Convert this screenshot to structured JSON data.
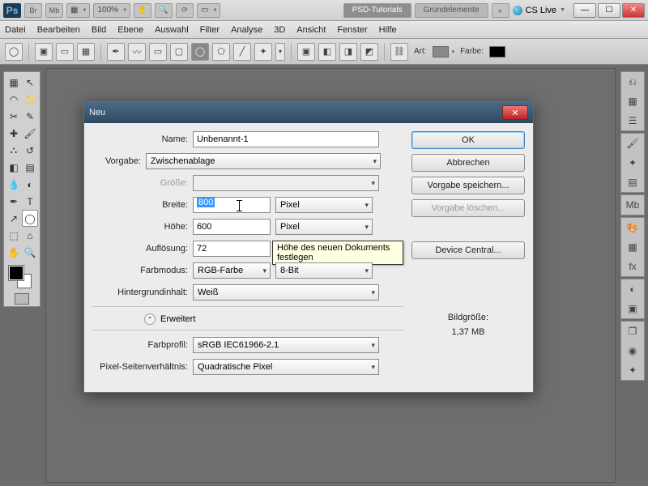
{
  "appbar": {
    "zoom": "100%",
    "tab_active": "PSD-Tutorials",
    "tab2": "Grundelemente",
    "cs_live": "CS Live"
  },
  "menu": [
    "Datei",
    "Bearbeiten",
    "Bild",
    "Ebene",
    "Auswahl",
    "Filter",
    "Analyse",
    "3D",
    "Ansicht",
    "Fenster",
    "Hilfe"
  ],
  "options": {
    "art": "Art:",
    "farbe": "Farbe:"
  },
  "dialog": {
    "title": "Neu",
    "labels": {
      "name": "Name:",
      "vorgabe": "Vorgabe:",
      "groesse": "Größe:",
      "breite": "Breite:",
      "hoehe": "Höhe:",
      "aufloesung": "Auflösung:",
      "farbmodus": "Farbmodus:",
      "hintergrund": "Hintergrundinhalt:",
      "erweitert": "Erweitert",
      "farbprofil": "Farbprofil:",
      "pixelsv": "Pixel-Seitenverhältnis:"
    },
    "values": {
      "name": "Unbenannt-1",
      "vorgabe": "Zwischenablage",
      "breite": "800",
      "hoehe": "600",
      "aufloesung": "72",
      "farbmodus": "RGB-Farbe",
      "bittiefe": "8-Bit",
      "hintergrund": "Weiß",
      "farbprofil": "sRGB IEC61966-2.1",
      "pixelsv": "Quadratische Pixel",
      "einheit_px": "Pixel"
    },
    "buttons": {
      "ok": "OK",
      "abbrechen": "Abbrechen",
      "save": "Vorgabe speichern...",
      "delete": "Vorgabe löschen...",
      "device": "Device Central..."
    },
    "bildgroesse_label": "Bildgröße:",
    "bildgroesse_value": "1,37 MB",
    "tooltip": "Höhe des neuen Dokuments festlegen"
  }
}
